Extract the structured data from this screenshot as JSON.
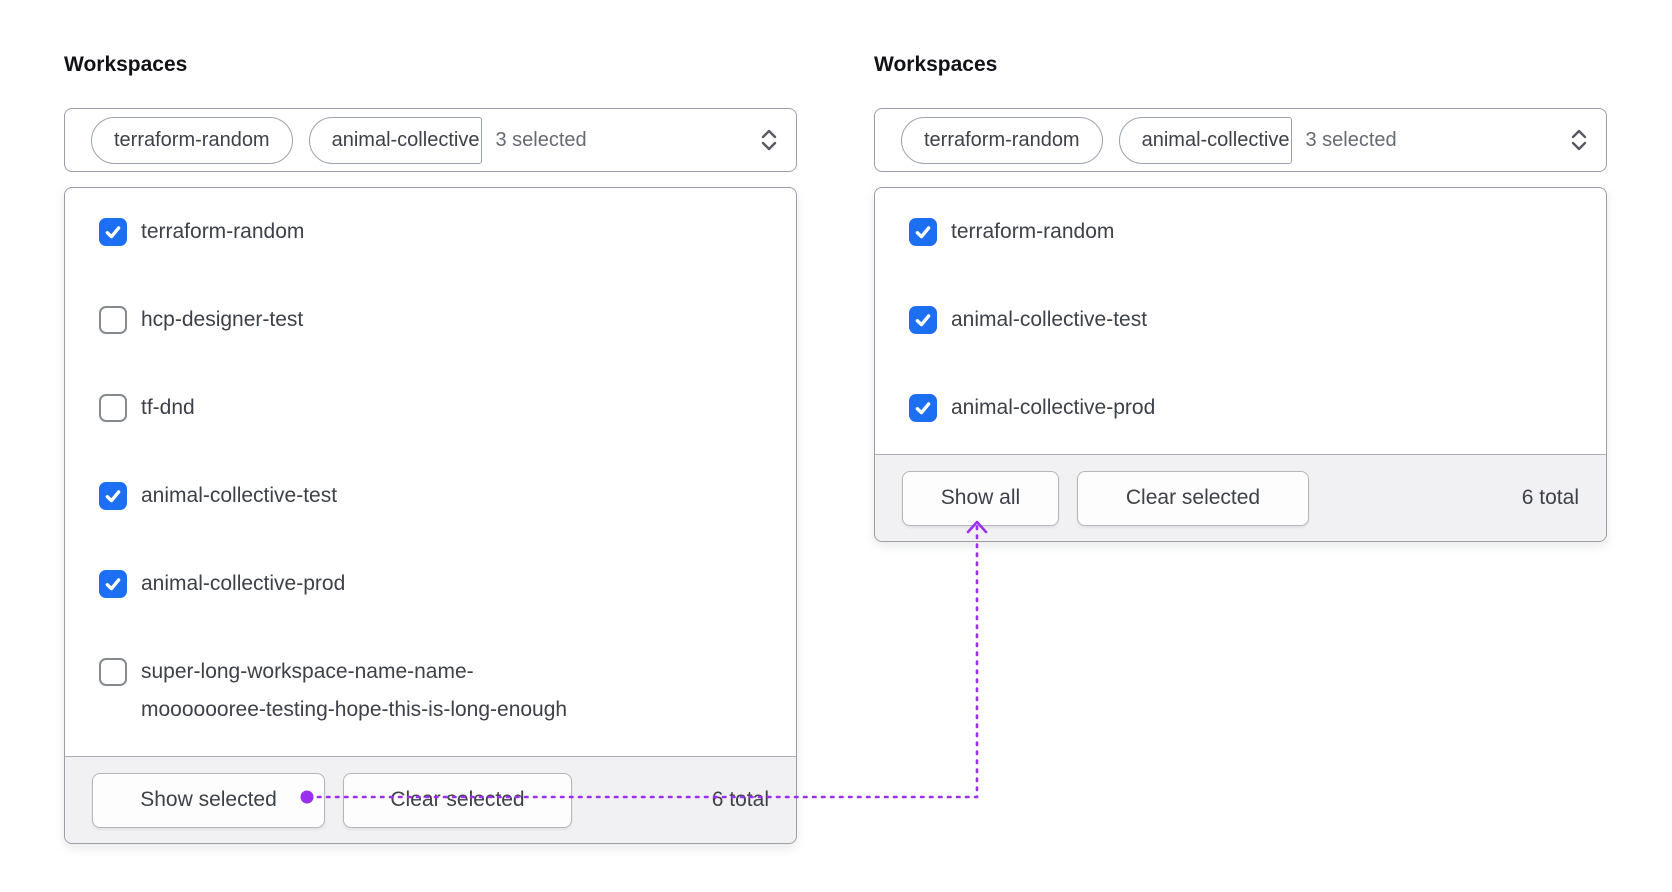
{
  "colors": {
    "checkbox_selected": "#1c6ef2",
    "annotation": "#9b30ef"
  },
  "panels": [
    {
      "label": "Workspaces",
      "trigger": {
        "pills": [
          {
            "label": "terraform-random"
          },
          {
            "label": "animal-collective",
            "truncated": true
          }
        ],
        "count_label": "3 selected"
      },
      "items": [
        {
          "label": "terraform-random",
          "checked": true
        },
        {
          "label": "hcp-designer-test",
          "checked": false
        },
        {
          "label": "tf-dnd",
          "checked": false
        },
        {
          "label": "animal-collective-test",
          "checked": true
        },
        {
          "label": "animal-collective-prod",
          "checked": true
        },
        {
          "label": "super-long-workspace-name-name-mooooooree-testing-hope-this-is-long-enough",
          "checked": false,
          "lines": [
            "super-long-workspace-name-name-",
            "mooooooree-testing-hope-this-is-long-enough"
          ]
        }
      ],
      "footer": {
        "primary": "Show selected",
        "secondary": "Clear selected",
        "total": "6 total"
      }
    },
    {
      "label": "Workspaces",
      "trigger": {
        "pills": [
          {
            "label": "terraform-random"
          },
          {
            "label": "animal-collective",
            "truncated": true
          }
        ],
        "count_label": "3 selected"
      },
      "items": [
        {
          "label": "terraform-random",
          "checked": true
        },
        {
          "label": "animal-collective-test",
          "checked": true
        },
        {
          "label": "animal-collective-prod",
          "checked": true
        }
      ],
      "footer": {
        "primary": "Show all",
        "secondary": "Clear selected",
        "total": "6 total"
      }
    }
  ]
}
